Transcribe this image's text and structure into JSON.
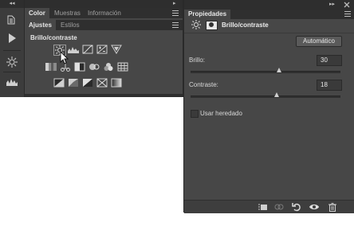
{
  "ajustes_panel": {
    "collapse_glyph": "◂◂",
    "top_tabs": [
      "Color",
      "Muestras",
      "Información"
    ],
    "tabs": [
      "Ajustes",
      "Estilos"
    ],
    "heading": "Brillo/contraste"
  },
  "properties_panel": {
    "expand_glyph": "▸▸",
    "tab": "Propiedades",
    "adjustment_title": "Brillo/contraste",
    "auto_button": "Automático",
    "brightness_label": "Brillo:",
    "brightness_value": "30",
    "contrast_label": "Contraste:",
    "contrast_value": "18",
    "legacy_label": "Usar heredado"
  },
  "tool_strip": {
    "collapse_glyph": "◂◂"
  },
  "colors": {
    "panel": "#474747",
    "dark": "#2f2f2f"
  }
}
